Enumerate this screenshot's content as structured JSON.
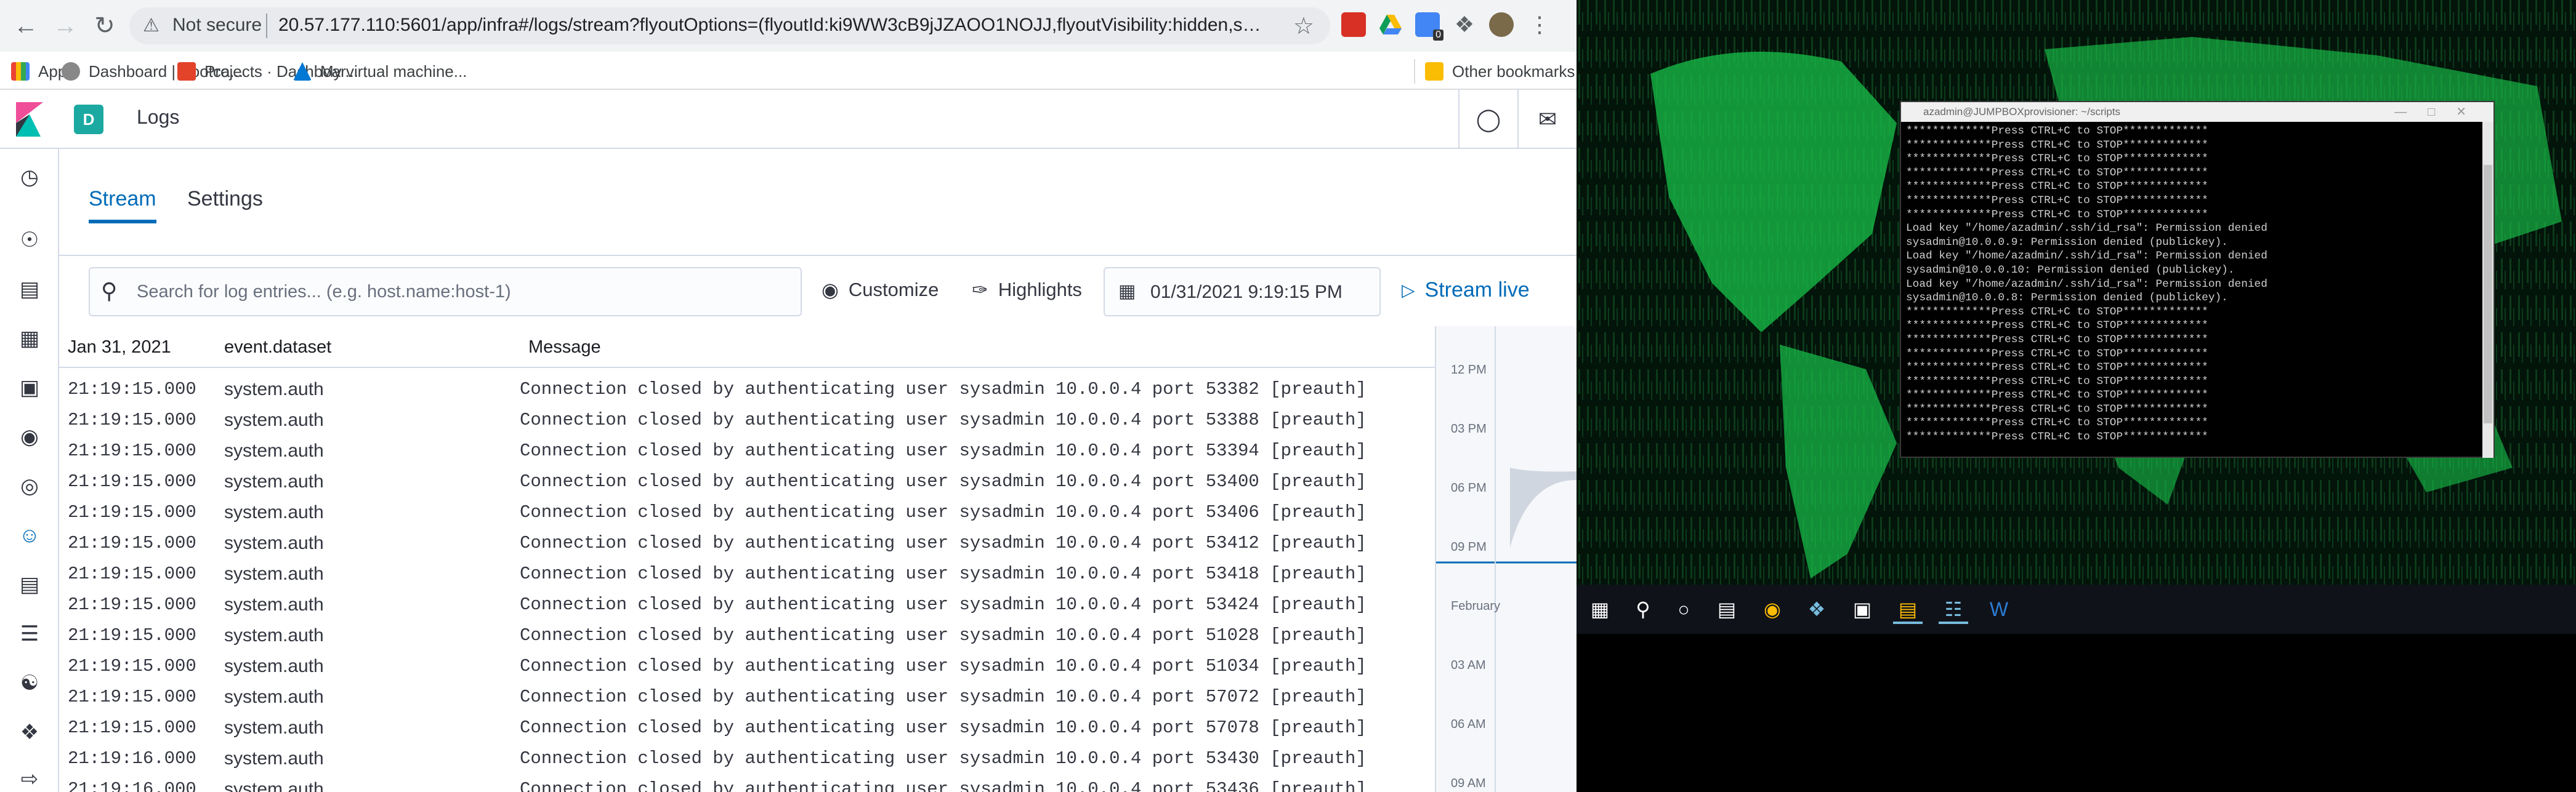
{
  "browser": {
    "url_security": "Not secure",
    "url": "20.57.177.110:5601/app/infra#/logs/stream?flyoutOptions=(flyoutId:ki9WW3cB9jJZAOO1NOJJ,flyoutVisibility:hidden,surrounding...",
    "ext_badge": "0",
    "bookmarks": [
      {
        "label": "Apps"
      },
      {
        "label": "Dashboard | Bootca..."
      },
      {
        "label": "Projects · Dashboar..."
      },
      {
        "label": "My virtual machine..."
      }
    ],
    "other_bookmarks": "Other bookmarks"
  },
  "kibana": {
    "space_initial": "D",
    "app_title": "Logs",
    "tabs": [
      {
        "label": "Stream",
        "active": true
      },
      {
        "label": "Settings",
        "active": false
      }
    ],
    "search_placeholder": "Search for log entries... (e.g. host.name:host-1)",
    "customize_label": "Customize",
    "highlights_label": "Highlights",
    "date": "01/31/2021 9:19:15 PM",
    "stream_live_label": "Stream live",
    "columns": {
      "timestamp": "Jan 31, 2021",
      "dataset": "event.dataset",
      "message": "Message"
    },
    "rows": [
      {
        "ts": "21:19:15.000",
        "ds": "system.auth",
        "msg": "Connection closed by authenticating user sysadmin 10.0.0.4 port 53382 [preauth]"
      },
      {
        "ts": "21:19:15.000",
        "ds": "system.auth",
        "msg": "Connection closed by authenticating user sysadmin 10.0.0.4 port 53388 [preauth]"
      },
      {
        "ts": "21:19:15.000",
        "ds": "system.auth",
        "msg": "Connection closed by authenticating user sysadmin 10.0.0.4 port 53394 [preauth]"
      },
      {
        "ts": "21:19:15.000",
        "ds": "system.auth",
        "msg": "Connection closed by authenticating user sysadmin 10.0.0.4 port 53400 [preauth]"
      },
      {
        "ts": "21:19:15.000",
        "ds": "system.auth",
        "msg": "Connection closed by authenticating user sysadmin 10.0.0.4 port 53406 [preauth]"
      },
      {
        "ts": "21:19:15.000",
        "ds": "system.auth",
        "msg": "Connection closed by authenticating user sysadmin 10.0.0.4 port 53412 [preauth]"
      },
      {
        "ts": "21:19:15.000",
        "ds": "system.auth",
        "msg": "Connection closed by authenticating user sysadmin 10.0.0.4 port 53418 [preauth]"
      },
      {
        "ts": "21:19:15.000",
        "ds": "system.auth",
        "msg": "Connection closed by authenticating user sysadmin 10.0.0.4 port 53424 [preauth]"
      },
      {
        "ts": "21:19:15.000",
        "ds": "system.auth",
        "msg": "Connection closed by authenticating user sysadmin 10.0.0.4 port 51028 [preauth]"
      },
      {
        "ts": "21:19:15.000",
        "ds": "system.auth",
        "msg": "Connection closed by authenticating user sysadmin 10.0.0.4 port 51034 [preauth]"
      },
      {
        "ts": "21:19:15.000",
        "ds": "system.auth",
        "msg": "Connection closed by authenticating user sysadmin 10.0.0.4 port 57072 [preauth]"
      },
      {
        "ts": "21:19:15.000",
        "ds": "system.auth",
        "msg": "Connection closed by authenticating user sysadmin 10.0.0.4 port 57078 [preauth]"
      },
      {
        "ts": "21:19:16.000",
        "ds": "system.auth",
        "msg": "Connection closed by authenticating user sysadmin 10.0.0.4 port 53430 [preauth]"
      },
      {
        "ts": "21:19:16.000",
        "ds": "system.auth",
        "msg": "Connection closed by authenticating user sysadmin 10.0.0.4 port 53436 [preauth]"
      }
    ],
    "minimap_labels": [
      "12 PM",
      "03 PM",
      "06 PM",
      "09 PM",
      "February",
      "03 AM",
      "06 AM",
      "09 AM"
    ]
  },
  "terminal": {
    "title": "azadmin@JUMPBOXprovisioner: ~/scripts",
    "lines": [
      "*************Press CTRL+C to STOP*************",
      "*************Press CTRL+C to STOP*************",
      "*************Press CTRL+C to STOP*************",
      "*************Press CTRL+C to STOP*************",
      "*************Press CTRL+C to STOP*************",
      "*************Press CTRL+C to STOP*************",
      "*************Press CTRL+C to STOP*************",
      "Load key \"/home/azadmin/.ssh/id_rsa\": Permission denied",
      "sysadmin@10.0.0.9: Permission denied (publickey).",
      "Load key \"/home/azadmin/.ssh/id_rsa\": Permission denied",
      "sysadmin@10.0.0.10: Permission denied (publickey).",
      "Load key \"/home/azadmin/.ssh/id_rsa\": Permission denied",
      "sysadmin@10.0.0.8: Permission denied (publickey).",
      "*************Press CTRL+C to STOP*************",
      "*************Press CTRL+C to STOP*************",
      "*************Press CTRL+C to STOP*************",
      "*************Press CTRL+C to STOP*************",
      "*************Press CTRL+C to STOP*************",
      "*************Press CTRL+C to STOP*************",
      "*************Press CTRL+C to STOP*************",
      "*************Press CTRL+C to STOP*************",
      "*************Press CTRL+C to STOP*************",
      "*************Press CTRL+C to STOP*************"
    ]
  },
  "colors": {
    "accent": "#006bb8",
    "space": "#1ba9a1",
    "matrix": "#18c24a"
  }
}
